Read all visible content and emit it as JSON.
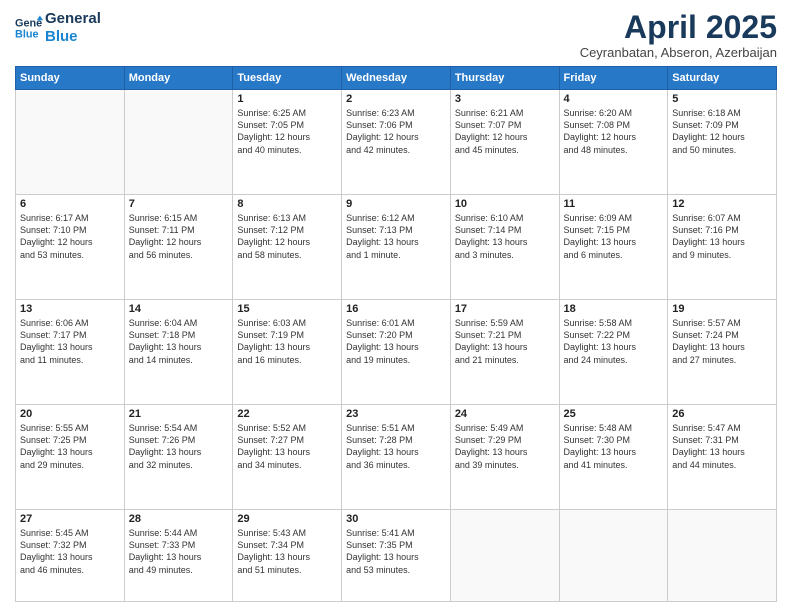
{
  "header": {
    "logo_line1": "General",
    "logo_line2": "Blue",
    "month_title": "April 2025",
    "location": "Ceyranbatan, Abseron, Azerbaijan"
  },
  "weekdays": [
    "Sunday",
    "Monday",
    "Tuesday",
    "Wednesday",
    "Thursday",
    "Friday",
    "Saturday"
  ],
  "weeks": [
    [
      {
        "day": "",
        "info": ""
      },
      {
        "day": "",
        "info": ""
      },
      {
        "day": "1",
        "info": "Sunrise: 6:25 AM\nSunset: 7:05 PM\nDaylight: 12 hours\nand 40 minutes."
      },
      {
        "day": "2",
        "info": "Sunrise: 6:23 AM\nSunset: 7:06 PM\nDaylight: 12 hours\nand 42 minutes."
      },
      {
        "day": "3",
        "info": "Sunrise: 6:21 AM\nSunset: 7:07 PM\nDaylight: 12 hours\nand 45 minutes."
      },
      {
        "day": "4",
        "info": "Sunrise: 6:20 AM\nSunset: 7:08 PM\nDaylight: 12 hours\nand 48 minutes."
      },
      {
        "day": "5",
        "info": "Sunrise: 6:18 AM\nSunset: 7:09 PM\nDaylight: 12 hours\nand 50 minutes."
      }
    ],
    [
      {
        "day": "6",
        "info": "Sunrise: 6:17 AM\nSunset: 7:10 PM\nDaylight: 12 hours\nand 53 minutes."
      },
      {
        "day": "7",
        "info": "Sunrise: 6:15 AM\nSunset: 7:11 PM\nDaylight: 12 hours\nand 56 minutes."
      },
      {
        "day": "8",
        "info": "Sunrise: 6:13 AM\nSunset: 7:12 PM\nDaylight: 12 hours\nand 58 minutes."
      },
      {
        "day": "9",
        "info": "Sunrise: 6:12 AM\nSunset: 7:13 PM\nDaylight: 13 hours\nand 1 minute."
      },
      {
        "day": "10",
        "info": "Sunrise: 6:10 AM\nSunset: 7:14 PM\nDaylight: 13 hours\nand 3 minutes."
      },
      {
        "day": "11",
        "info": "Sunrise: 6:09 AM\nSunset: 7:15 PM\nDaylight: 13 hours\nand 6 minutes."
      },
      {
        "day": "12",
        "info": "Sunrise: 6:07 AM\nSunset: 7:16 PM\nDaylight: 13 hours\nand 9 minutes."
      }
    ],
    [
      {
        "day": "13",
        "info": "Sunrise: 6:06 AM\nSunset: 7:17 PM\nDaylight: 13 hours\nand 11 minutes."
      },
      {
        "day": "14",
        "info": "Sunrise: 6:04 AM\nSunset: 7:18 PM\nDaylight: 13 hours\nand 14 minutes."
      },
      {
        "day": "15",
        "info": "Sunrise: 6:03 AM\nSunset: 7:19 PM\nDaylight: 13 hours\nand 16 minutes."
      },
      {
        "day": "16",
        "info": "Sunrise: 6:01 AM\nSunset: 7:20 PM\nDaylight: 13 hours\nand 19 minutes."
      },
      {
        "day": "17",
        "info": "Sunrise: 5:59 AM\nSunset: 7:21 PM\nDaylight: 13 hours\nand 21 minutes."
      },
      {
        "day": "18",
        "info": "Sunrise: 5:58 AM\nSunset: 7:22 PM\nDaylight: 13 hours\nand 24 minutes."
      },
      {
        "day": "19",
        "info": "Sunrise: 5:57 AM\nSunset: 7:24 PM\nDaylight: 13 hours\nand 27 minutes."
      }
    ],
    [
      {
        "day": "20",
        "info": "Sunrise: 5:55 AM\nSunset: 7:25 PM\nDaylight: 13 hours\nand 29 minutes."
      },
      {
        "day": "21",
        "info": "Sunrise: 5:54 AM\nSunset: 7:26 PM\nDaylight: 13 hours\nand 32 minutes."
      },
      {
        "day": "22",
        "info": "Sunrise: 5:52 AM\nSunset: 7:27 PM\nDaylight: 13 hours\nand 34 minutes."
      },
      {
        "day": "23",
        "info": "Sunrise: 5:51 AM\nSunset: 7:28 PM\nDaylight: 13 hours\nand 36 minutes."
      },
      {
        "day": "24",
        "info": "Sunrise: 5:49 AM\nSunset: 7:29 PM\nDaylight: 13 hours\nand 39 minutes."
      },
      {
        "day": "25",
        "info": "Sunrise: 5:48 AM\nSunset: 7:30 PM\nDaylight: 13 hours\nand 41 minutes."
      },
      {
        "day": "26",
        "info": "Sunrise: 5:47 AM\nSunset: 7:31 PM\nDaylight: 13 hours\nand 44 minutes."
      }
    ],
    [
      {
        "day": "27",
        "info": "Sunrise: 5:45 AM\nSunset: 7:32 PM\nDaylight: 13 hours\nand 46 minutes."
      },
      {
        "day": "28",
        "info": "Sunrise: 5:44 AM\nSunset: 7:33 PM\nDaylight: 13 hours\nand 49 minutes."
      },
      {
        "day": "29",
        "info": "Sunrise: 5:43 AM\nSunset: 7:34 PM\nDaylight: 13 hours\nand 51 minutes."
      },
      {
        "day": "30",
        "info": "Sunrise: 5:41 AM\nSunset: 7:35 PM\nDaylight: 13 hours\nand 53 minutes."
      },
      {
        "day": "",
        "info": ""
      },
      {
        "day": "",
        "info": ""
      },
      {
        "day": "",
        "info": ""
      }
    ]
  ]
}
